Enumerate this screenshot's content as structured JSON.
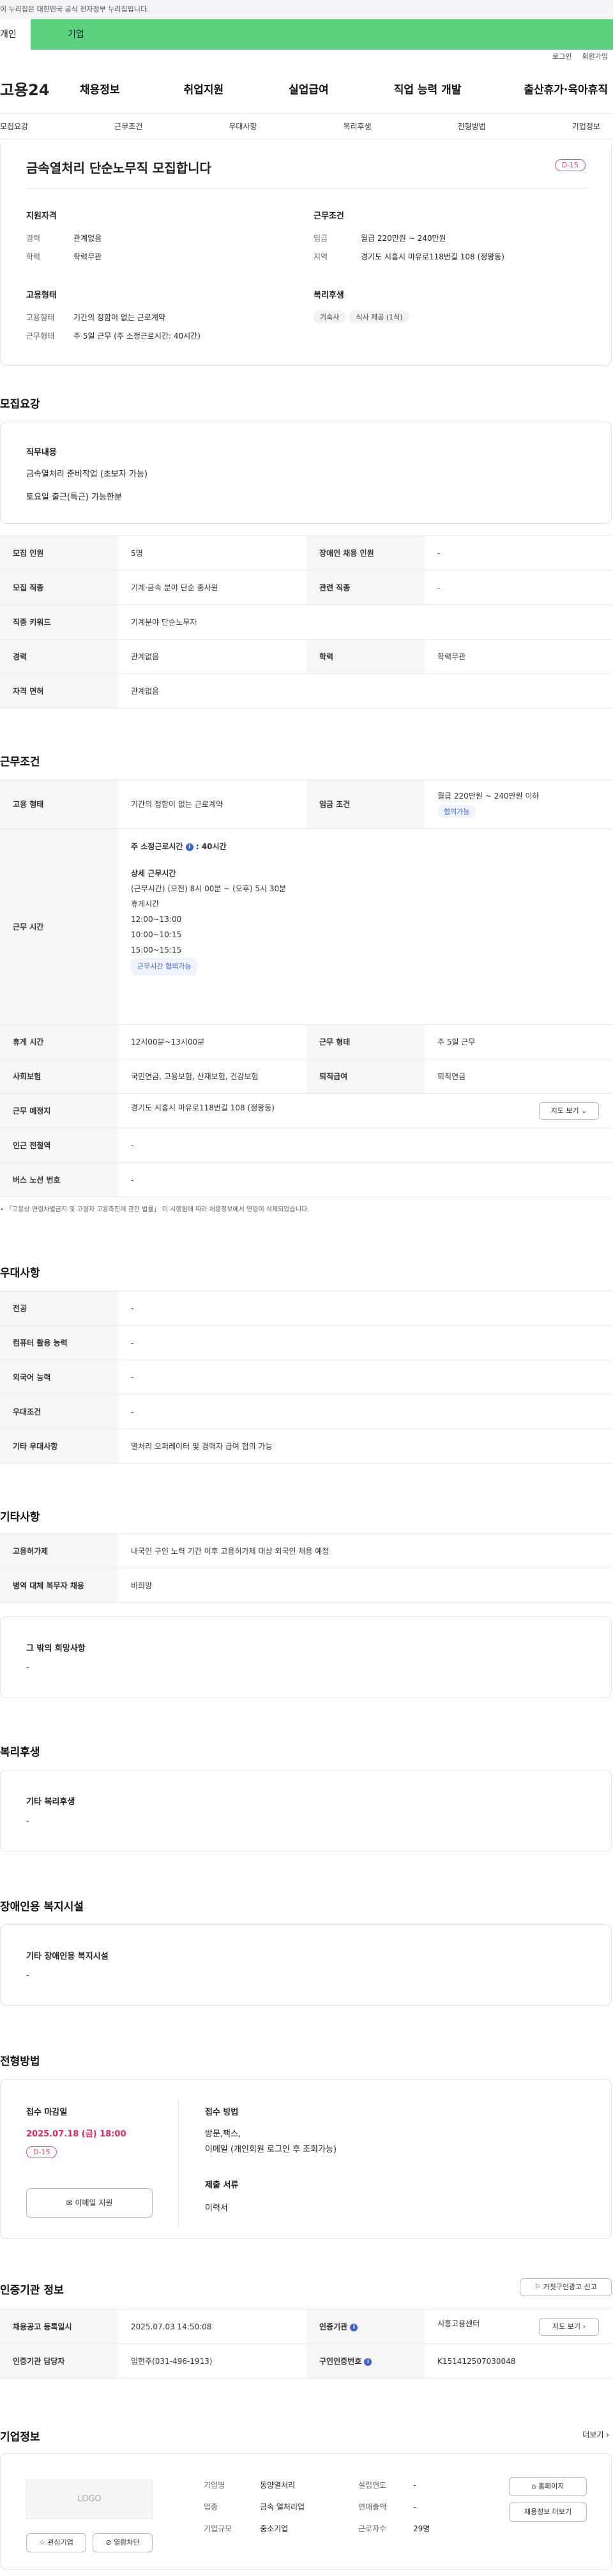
{
  "banner": "이 누리집은 대한민국 공식 전자정부 누리집입니다.",
  "org_tabs": [
    "개인",
    "기업"
  ],
  "util": [
    "로그인",
    "회원가입"
  ],
  "logo": "고용24",
  "gnb": [
    "채용정보",
    "취업지원",
    "실업급여",
    "직업 능력 개발",
    "출산휴가·육아휴직"
  ],
  "subnav": [
    "모집요강",
    "근무조건",
    "우대사항",
    "복리후생",
    "전형방법",
    "기업정보"
  ],
  "job": {
    "title": "금속열처리 단순노무직 모집합니다",
    "dday": "D-15"
  },
  "summary": {
    "qual_title": "지원자격",
    "qual": [
      {
        "k": "경력",
        "v": "관계없음"
      },
      {
        "k": "학력",
        "v": "학력무관"
      }
    ],
    "cond_title": "근무조건",
    "cond": [
      {
        "k": "임금",
        "v": "월급 220만원 ~ 240만원"
      },
      {
        "k": "지역",
        "v": "경기도 시흥시 마유로118번길 108 (정왕동)"
      }
    ],
    "emp_title": "고용형태",
    "emp": [
      {
        "k": "고용형태",
        "v": "기간의 정함이 없는 근로계약"
      },
      {
        "k": "근무형태",
        "v": "주 5일 근무 (주 소정근로시간: 40시간)"
      }
    ],
    "welfare_title": "복리후생",
    "welfare": [
      "기숙사",
      "식사 제공 (1식)"
    ]
  },
  "recruit": {
    "title": "모집요강",
    "duty_title": "직무내용",
    "duty_lines": [
      "금속열처리 준비작업 (초보자 가능)",
      "토요일 출근(특근) 가능한분"
    ],
    "rows": [
      [
        "모집 인원",
        "5명",
        "장애인 채용 인원",
        "-"
      ],
      [
        "모집 직종",
        "기계·금속 분야 단순 종사원",
        "관련 직종",
        "-"
      ],
      [
        "직종 키워드",
        "기계분야 단순노무자"
      ],
      [
        "경력",
        "관계없음",
        "학력",
        "학력무관"
      ],
      [
        "자격 면허",
        "관계없음"
      ]
    ]
  },
  "work": {
    "title": "근무조건",
    "type_h": "고용 형태",
    "type_v": "기간의 정함이 없는 근로계약",
    "wage_h": "임금 조건",
    "wage_v": "월급 220만원 ~ 240만원 이하",
    "wage_chip": "협의가능",
    "hours_h": "근무 시간",
    "hours_weekly": "주 소정근로시간",
    "hours_weekly_v": ": 40시간",
    "hours_detail_t": "상세 근무시간",
    "hours_lines": [
      "(근무시간) (오전) 8시 00분 ~ (오후) 5시 30분",
      "휴게시간",
      "12:00~13:00",
      "10:00~10:15",
      "15:00~15:15"
    ],
    "hours_chip": "근무시간 협의가능",
    "rows": [
      [
        "휴게 시간",
        "12시00분~13시00분",
        "근무 형태",
        "주 5일 근무"
      ],
      [
        "사회보험",
        "국민연금, 고용보험, 산재보험, 건강보험",
        "퇴직급여",
        "퇴직연금"
      ]
    ],
    "place_h": "근무 예정지",
    "place_v": "경기도 시흥시 마유로118번길 108 (정왕동)",
    "map_btn": "지도 보기",
    "station_h": "인근 전철역",
    "station_v": "-",
    "bus_h": "버스 노선 번호",
    "bus_v": "-",
    "note": "「고용상 연령차별금지 및 고령자 고용촉진에 관한 법률」 이 시행됨에 따라 채용정보에서 연령이 삭제되었습니다."
  },
  "pref": {
    "title": "우대사항",
    "rows": [
      [
        "전공",
        "-"
      ],
      [
        "컴퓨터 활용 능력",
        "-"
      ],
      [
        "외국어 능력",
        "-"
      ],
      [
        "우대조건",
        "-"
      ],
      [
        "기타 우대사항",
        "열처리 오퍼레이터 및 경력자 급여 협의 가능"
      ]
    ]
  },
  "etc": {
    "title": "기타사항",
    "rows": [
      [
        "고용허가제",
        "내국인 구인 노력 기간 이후 고용허가제 대상 외국인 채용 예정"
      ],
      [
        "병역 대체 복무자 채용",
        "비희망"
      ]
    ],
    "other_t": "그 밖의 희망사항",
    "other_v": "-"
  },
  "benefit": {
    "title": "복리후생",
    "box_t": "기타 복리후생",
    "box_v": "-"
  },
  "disab": {
    "title": "장애인용 복지시설",
    "box_t": "기타 장애인용 복지시설",
    "box_v": "-"
  },
  "process": {
    "title": "전형방법",
    "deadline_t": "접수 마감일",
    "deadline_v": "2025.07.18 (금) 18:00",
    "dday": "D-15",
    "email_btn": "이메일 지원",
    "method_t": "접수 방법",
    "method_lines": [
      "방문,팩스,",
      "이메일 (개인회원 로그인 후 조회가능)"
    ],
    "docs_t": "제출 서류",
    "docs_v": "이력서"
  },
  "auth": {
    "title": "인증기관 정보",
    "report_btn": "거짓구인광고 신고",
    "r1": [
      "채용공고 등록일시",
      "2025.07.03 14:50:08",
      "인증기관",
      "시흥고용센터"
    ],
    "r2": [
      "인증기관 담당자",
      "임현주(031-496-1913)",
      "구인인증번호",
      "K151412507030048"
    ],
    "map_btn": "지도 보기"
  },
  "company": {
    "title": "기업정보",
    "more": "더보기",
    "logo": "LOGO",
    "like_btn": "관심기업",
    "block_btn": "열람차단",
    "fields": [
      [
        "기업명",
        "동양열처리",
        "설립연도",
        "-"
      ],
      [
        "업종",
        "금속 열처리업",
        "연매출액",
        "-"
      ],
      [
        "기업규모",
        "중소기업",
        "근로자수",
        "29명"
      ]
    ],
    "home_btn": "홈페이지",
    "jobs_btn": "채용정보 더보기"
  }
}
